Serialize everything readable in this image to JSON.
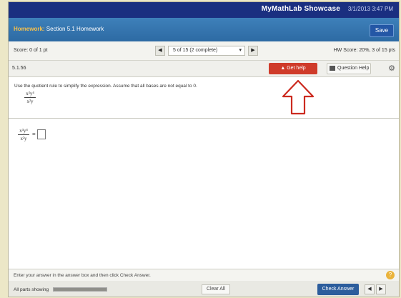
{
  "topbar": {
    "title": "MyMathLab Showcase",
    "time": "3/1/2013 3:47 PM"
  },
  "homework": {
    "label": "Homework:",
    "title": "Section 5.1 Homework",
    "save_label": "Save"
  },
  "scorebar": {
    "score": "Score: 0 of 1 pt",
    "question_selector": "5 of 15 (2 complete)",
    "prev_label": "◀",
    "next_label": "▶",
    "hw_score": "HW Score: 20%, 3 of 15 pts"
  },
  "toolbar": {
    "question_number": "5.1.56",
    "get_help_label": "Get help",
    "question_help_label": "Question Help",
    "gear_label": "⚙"
  },
  "problem": {
    "instructions": "Use the quotient rule to simplify the expression. Assume that all bases are not equal to 0.",
    "given_numerator": "x³y⁴",
    "given_denominator": "x²y",
    "answer_numerator": "x³y⁴",
    "answer_denominator": "x²y",
    "equals": "=",
    "answer_value": ""
  },
  "status": {
    "instructions": "Enter your answer in the answer box and then click Check Answer.",
    "hint_label": "?"
  },
  "bottom": {
    "parts_label": "All parts showing",
    "progress": 1.0,
    "clear_all_label": "Clear All",
    "check_answer_label": "Check Answer",
    "prev_page": "◀",
    "next_page": "▶"
  },
  "colors": {
    "top": "#1a2f80",
    "hw_bar": "#2d6aa3",
    "help": "#cf3b2a",
    "arrow": "#cc2a1f",
    "check": "#2c5d9c"
  },
  "icons": {
    "arrow": "red-up-arrow-outline",
    "gear": "gear-icon",
    "grid": "grid-icon",
    "hint": "help-circle-icon"
  }
}
